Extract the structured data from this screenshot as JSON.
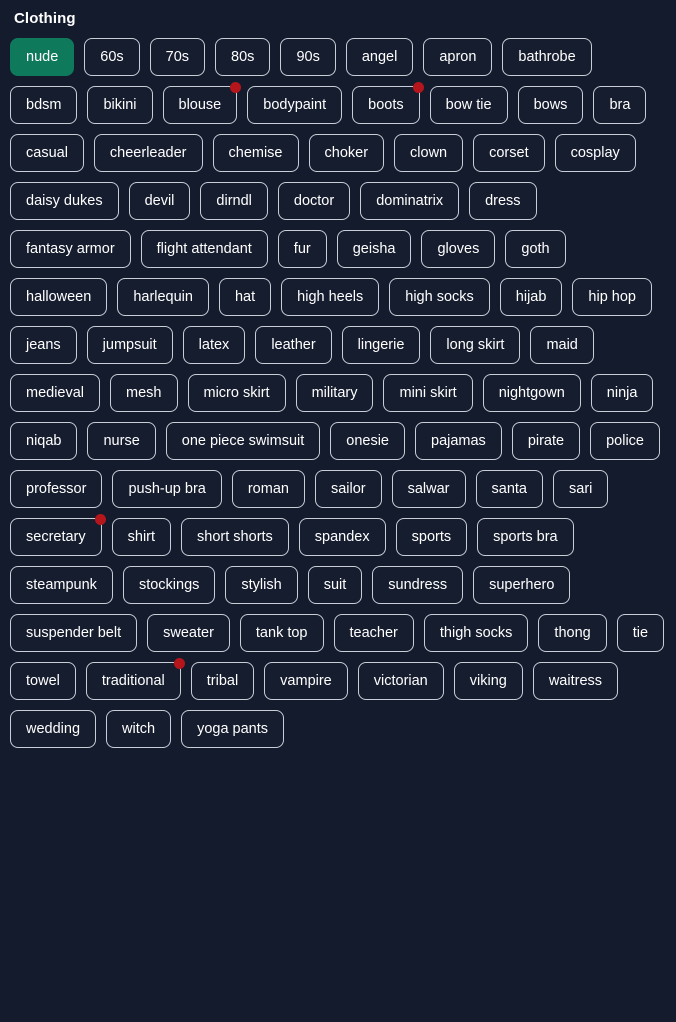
{
  "panel": {
    "title": "Clothing",
    "background_color": "#141b2d",
    "selected_color": "#0e7a5b",
    "badge_color": "#b4161b",
    "border_color": "#c9cdd6",
    "text_color": "#ffffff"
  },
  "tags": [
    {
      "label": "nude",
      "selected": true,
      "badge": false
    },
    {
      "label": "60s",
      "selected": false,
      "badge": false
    },
    {
      "label": "70s",
      "selected": false,
      "badge": false
    },
    {
      "label": "80s",
      "selected": false,
      "badge": false
    },
    {
      "label": "90s",
      "selected": false,
      "badge": false
    },
    {
      "label": "angel",
      "selected": false,
      "badge": false
    },
    {
      "label": "apron",
      "selected": false,
      "badge": false
    },
    {
      "label": "bathrobe",
      "selected": false,
      "badge": false
    },
    {
      "label": "bdsm",
      "selected": false,
      "badge": false
    },
    {
      "label": "bikini",
      "selected": false,
      "badge": false
    },
    {
      "label": "blouse",
      "selected": false,
      "badge": true
    },
    {
      "label": "bodypaint",
      "selected": false,
      "badge": false
    },
    {
      "label": "boots",
      "selected": false,
      "badge": true
    },
    {
      "label": "bow tie",
      "selected": false,
      "badge": false
    },
    {
      "label": "bows",
      "selected": false,
      "badge": false
    },
    {
      "label": "bra",
      "selected": false,
      "badge": false
    },
    {
      "label": "casual",
      "selected": false,
      "badge": false
    },
    {
      "label": "cheerleader",
      "selected": false,
      "badge": false
    },
    {
      "label": "chemise",
      "selected": false,
      "badge": false
    },
    {
      "label": "choker",
      "selected": false,
      "badge": false
    },
    {
      "label": "clown",
      "selected": false,
      "badge": false
    },
    {
      "label": "corset",
      "selected": false,
      "badge": false
    },
    {
      "label": "cosplay",
      "selected": false,
      "badge": false
    },
    {
      "label": "daisy dukes",
      "selected": false,
      "badge": false
    },
    {
      "label": "devil",
      "selected": false,
      "badge": false
    },
    {
      "label": "dirndl",
      "selected": false,
      "badge": false
    },
    {
      "label": "doctor",
      "selected": false,
      "badge": false
    },
    {
      "label": "dominatrix",
      "selected": false,
      "badge": false
    },
    {
      "label": "dress",
      "selected": false,
      "badge": false
    },
    {
      "label": "fantasy armor",
      "selected": false,
      "badge": false
    },
    {
      "label": "flight attendant",
      "selected": false,
      "badge": false
    },
    {
      "label": "fur",
      "selected": false,
      "badge": false
    },
    {
      "label": "geisha",
      "selected": false,
      "badge": false
    },
    {
      "label": "gloves",
      "selected": false,
      "badge": false
    },
    {
      "label": "goth",
      "selected": false,
      "badge": false
    },
    {
      "label": "halloween",
      "selected": false,
      "badge": false
    },
    {
      "label": "harlequin",
      "selected": false,
      "badge": false
    },
    {
      "label": "hat",
      "selected": false,
      "badge": false
    },
    {
      "label": "high heels",
      "selected": false,
      "badge": false
    },
    {
      "label": "high socks",
      "selected": false,
      "badge": false
    },
    {
      "label": "hijab",
      "selected": false,
      "badge": false
    },
    {
      "label": "hip hop",
      "selected": false,
      "badge": false
    },
    {
      "label": "jeans",
      "selected": false,
      "badge": false
    },
    {
      "label": "jumpsuit",
      "selected": false,
      "badge": false
    },
    {
      "label": "latex",
      "selected": false,
      "badge": false
    },
    {
      "label": "leather",
      "selected": false,
      "badge": false
    },
    {
      "label": "lingerie",
      "selected": false,
      "badge": false
    },
    {
      "label": "long skirt",
      "selected": false,
      "badge": false
    },
    {
      "label": "maid",
      "selected": false,
      "badge": false
    },
    {
      "label": "medieval",
      "selected": false,
      "badge": false
    },
    {
      "label": "mesh",
      "selected": false,
      "badge": false
    },
    {
      "label": "micro skirt",
      "selected": false,
      "badge": false
    },
    {
      "label": "military",
      "selected": false,
      "badge": false
    },
    {
      "label": "mini skirt",
      "selected": false,
      "badge": false
    },
    {
      "label": "nightgown",
      "selected": false,
      "badge": false
    },
    {
      "label": "ninja",
      "selected": false,
      "badge": false
    },
    {
      "label": "niqab",
      "selected": false,
      "badge": false
    },
    {
      "label": "nurse",
      "selected": false,
      "badge": false
    },
    {
      "label": "one piece swimsuit",
      "selected": false,
      "badge": false
    },
    {
      "label": "onesie",
      "selected": false,
      "badge": false
    },
    {
      "label": "pajamas",
      "selected": false,
      "badge": false
    },
    {
      "label": "pirate",
      "selected": false,
      "badge": false
    },
    {
      "label": "police",
      "selected": false,
      "badge": false
    },
    {
      "label": "professor",
      "selected": false,
      "badge": false
    },
    {
      "label": "push-up bra",
      "selected": false,
      "badge": false
    },
    {
      "label": "roman",
      "selected": false,
      "badge": false
    },
    {
      "label": "sailor",
      "selected": false,
      "badge": false
    },
    {
      "label": "salwar",
      "selected": false,
      "badge": false
    },
    {
      "label": "santa",
      "selected": false,
      "badge": false
    },
    {
      "label": "sari",
      "selected": false,
      "badge": false
    },
    {
      "label": "secretary",
      "selected": false,
      "badge": true
    },
    {
      "label": "shirt",
      "selected": false,
      "badge": false
    },
    {
      "label": "short shorts",
      "selected": false,
      "badge": false
    },
    {
      "label": "spandex",
      "selected": false,
      "badge": false
    },
    {
      "label": "sports",
      "selected": false,
      "badge": false
    },
    {
      "label": "sports bra",
      "selected": false,
      "badge": false
    },
    {
      "label": "steampunk",
      "selected": false,
      "badge": false
    },
    {
      "label": "stockings",
      "selected": false,
      "badge": false
    },
    {
      "label": "stylish",
      "selected": false,
      "badge": false
    },
    {
      "label": "suit",
      "selected": false,
      "badge": false
    },
    {
      "label": "sundress",
      "selected": false,
      "badge": false
    },
    {
      "label": "superhero",
      "selected": false,
      "badge": false
    },
    {
      "label": "suspender belt",
      "selected": false,
      "badge": false
    },
    {
      "label": "sweater",
      "selected": false,
      "badge": false
    },
    {
      "label": "tank top",
      "selected": false,
      "badge": false
    },
    {
      "label": "teacher",
      "selected": false,
      "badge": false
    },
    {
      "label": "thigh socks",
      "selected": false,
      "badge": false
    },
    {
      "label": "thong",
      "selected": false,
      "badge": false
    },
    {
      "label": "tie",
      "selected": false,
      "badge": false
    },
    {
      "label": "towel",
      "selected": false,
      "badge": false
    },
    {
      "label": "traditional",
      "selected": false,
      "badge": true
    },
    {
      "label": "tribal",
      "selected": false,
      "badge": false
    },
    {
      "label": "vampire",
      "selected": false,
      "badge": false
    },
    {
      "label": "victorian",
      "selected": false,
      "badge": false
    },
    {
      "label": "viking",
      "selected": false,
      "badge": false
    },
    {
      "label": "waitress",
      "selected": false,
      "badge": false
    },
    {
      "label": "wedding",
      "selected": false,
      "badge": false
    },
    {
      "label": "witch",
      "selected": false,
      "badge": false
    },
    {
      "label": "yoga pants",
      "selected": false,
      "badge": false
    }
  ]
}
